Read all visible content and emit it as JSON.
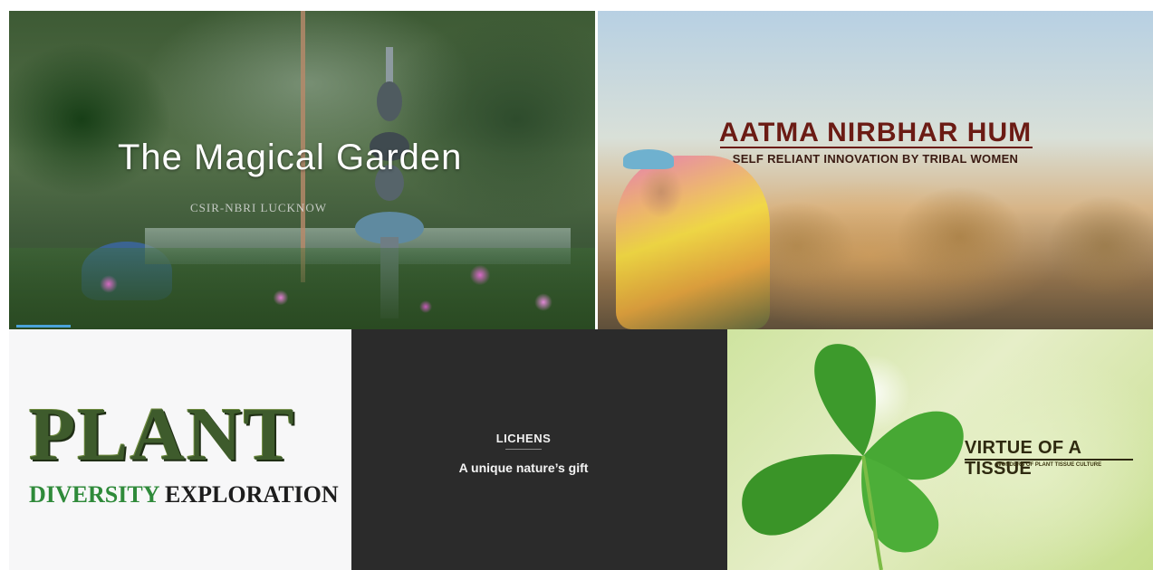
{
  "tiles": {
    "magical_garden": {
      "title": "The Magical Garden",
      "subtitle": "CSIR-NBRI LUCKNOW"
    },
    "aatma_nirbhar": {
      "title": "AATMA NIRBHAR HUM",
      "subtitle": "SELF RELIANT INNOVATION BY TRIBAL WOMEN"
    },
    "plant_diversity": {
      "title": "PLANT",
      "subtitle_green": "DIVERSITY",
      "subtitle_dark": "EXPLORATION"
    },
    "lichens": {
      "title": "LICHENS",
      "subtitle": "A unique nature’s gift"
    },
    "virtue_tissue": {
      "title": "VIRTUE OF A TISSUE",
      "subtitle": "WONDERS OF PLANT TISSUE CULTURE"
    }
  },
  "colors": {
    "maroon": "#6b1b14",
    "plant_green": "#2f8a3a",
    "dark_panel": "#2b2b2b"
  }
}
